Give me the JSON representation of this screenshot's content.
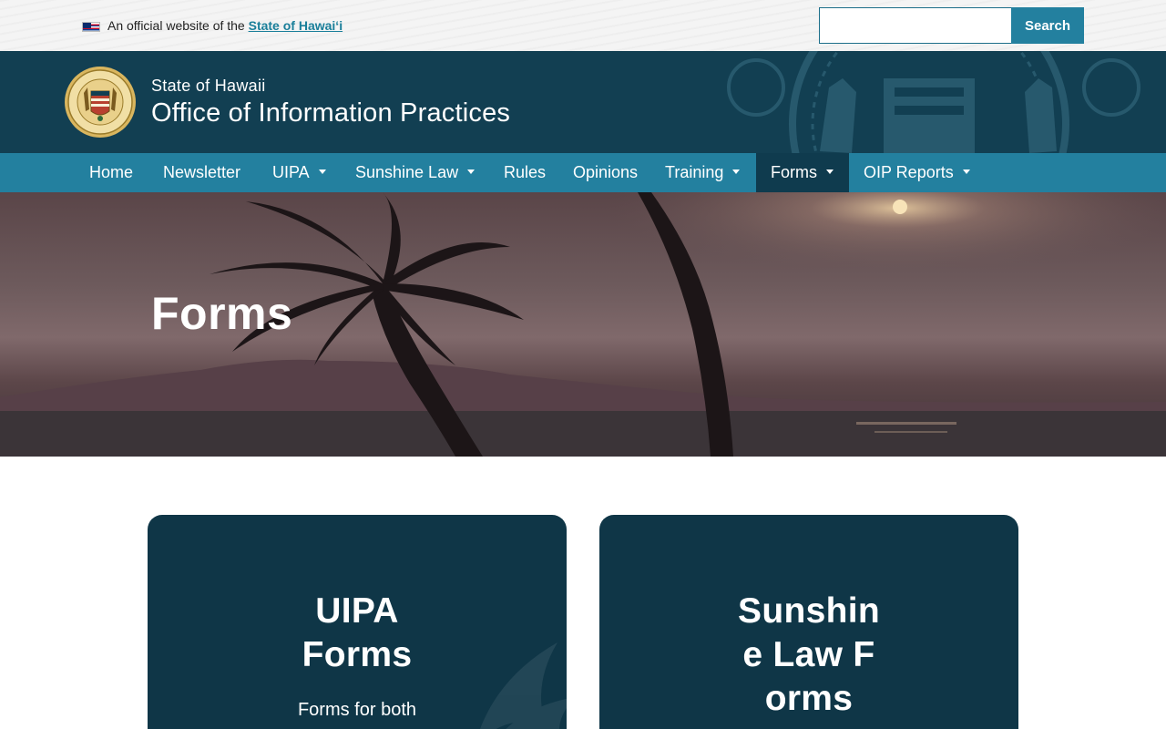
{
  "topbar": {
    "official_prefix": "An official website of the ",
    "official_link": "State of Hawaiʻi"
  },
  "search": {
    "placeholder": "",
    "button_label": "Search"
  },
  "header": {
    "state_label": "State of Hawaii",
    "org_name": "Office of Information Practices"
  },
  "nav": {
    "items": [
      {
        "label": "Home"
      },
      {
        "label": "Newsletter"
      },
      {
        "label": "UIPA"
      },
      {
        "label": "Sunshine Law"
      },
      {
        "label": "Rules"
      },
      {
        "label": "Opinions"
      },
      {
        "label": "Training"
      },
      {
        "label": "Forms"
      },
      {
        "label": "OIP Reports"
      }
    ]
  },
  "hero": {
    "title": "Forms"
  },
  "cards": [
    {
      "title": "UIPA Forms",
      "description": "Forms for both"
    },
    {
      "title": "Sunshine Law Forms",
      "description": ""
    }
  ],
  "colors": {
    "nav_bg": "#23809f",
    "header_bg": "#123f52",
    "card_bg": "#0f3647",
    "active_nav_bg": "#0f3b4e"
  }
}
